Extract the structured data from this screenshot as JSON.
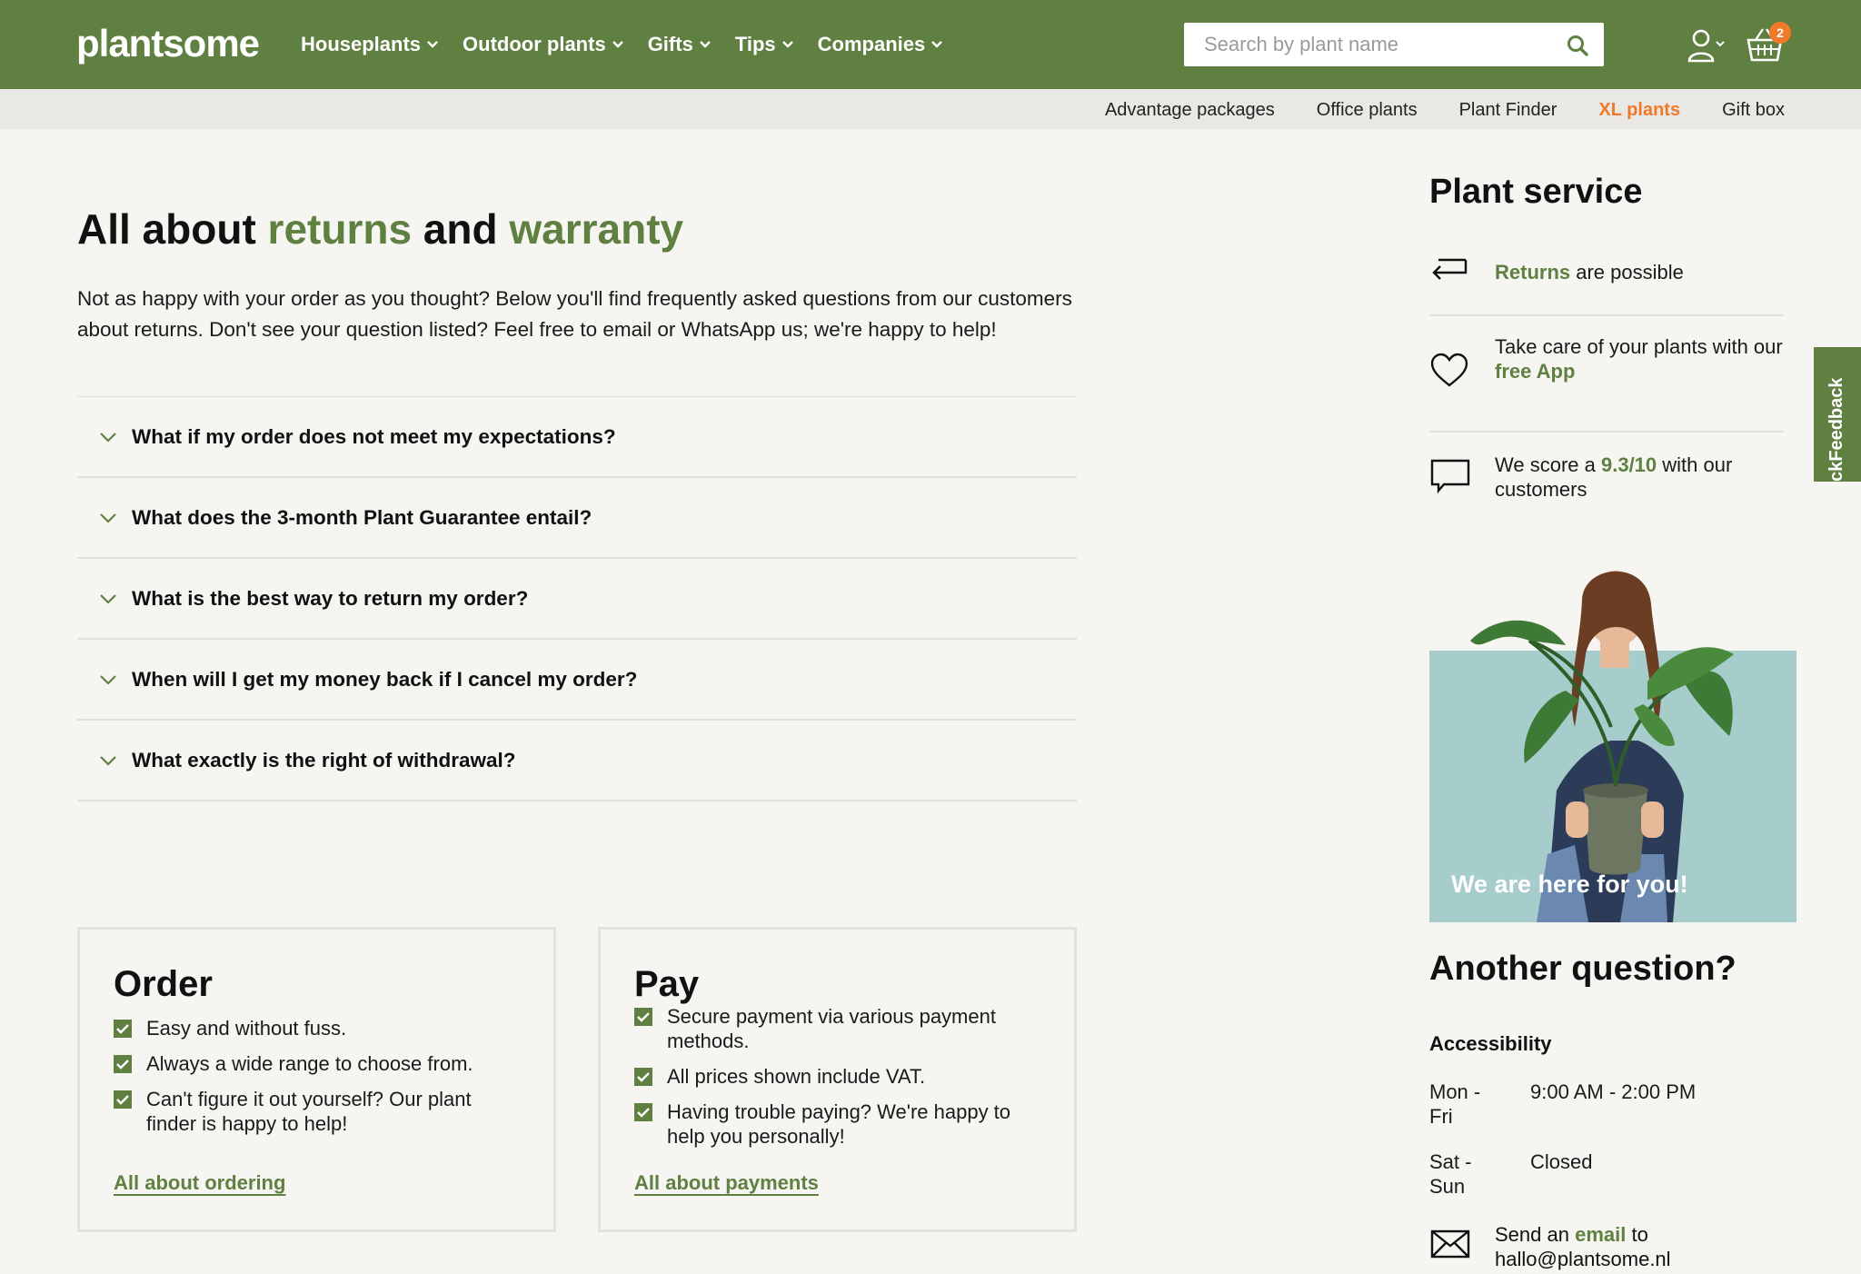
{
  "header": {
    "logo": "plantsome",
    "nav": [
      {
        "label": "Houseplants"
      },
      {
        "label": "Outdoor plants"
      },
      {
        "label": "Gifts"
      },
      {
        "label": "Tips"
      },
      {
        "label": "Companies"
      }
    ],
    "search_placeholder": "Search by plant name",
    "cart_count": "2"
  },
  "subnav": [
    {
      "label": "Advantage packages"
    },
    {
      "label": "Office plants"
    },
    {
      "label": "Plant Finder"
    },
    {
      "label": "XL plants"
    },
    {
      "label": "Gift box"
    }
  ],
  "page": {
    "title_parts": [
      "All about ",
      "returns",
      " and ",
      "warranty"
    ],
    "intro": "Not as happy with your order as you thought? Below you'll find frequently asked questions from our customers about returns. Don't see your question listed? Feel free to email or WhatsApp us; we're happy to help!"
  },
  "faq": [
    {
      "q": "What if my order does not meet my expectations?"
    },
    {
      "q": "What does the 3-month Plant Guarantee entail?"
    },
    {
      "q": "What is the best way to return my order?"
    },
    {
      "q": "When will I get my money back if I cancel my order?"
    },
    {
      "q": "What exactly is the right of withdrawal?"
    }
  ],
  "cards": {
    "order": {
      "title": "Order",
      "items": [
        "Easy and without fuss.",
        "Always a wide range to choose from.",
        "Can't figure it out yourself? Our plant finder is happy to help!"
      ],
      "link": "All about ordering"
    },
    "pay": {
      "title": "Pay",
      "items": [
        "Secure payment via various payment methods.",
        "All prices shown include VAT.",
        "Having trouble paying? We're happy to help you personally!"
      ],
      "link": "All about payments"
    }
  },
  "sidebar": {
    "title": "Plant service",
    "returns": {
      "highlight": "Returns",
      "rest": " are possible"
    },
    "app": {
      "pre": "Take care of your plants with our",
      "highlight": "free App"
    },
    "score": {
      "pre": "We score a ",
      "highlight": "9.3/10",
      "post": " with our customers"
    },
    "promo_caption": "We are here for you!",
    "another_question": "Another question?",
    "accessibility": "Accessibility",
    "hours": [
      {
        "days": "Mon - Fri",
        "time": "9:00 AM - 2:00 PM"
      },
      {
        "days": "Sat - Sun",
        "time": "Closed"
      }
    ],
    "email": {
      "pre": "Send an ",
      "highlight": "email",
      "post": " to",
      "address": "hallo@plantsome.nl"
    }
  },
  "feedback_tab": "ckFeedback",
  "colors": {
    "brand_green": "#5f8040",
    "accent_orange": "#f07a2a",
    "promo_bg": "#a6cccc"
  }
}
